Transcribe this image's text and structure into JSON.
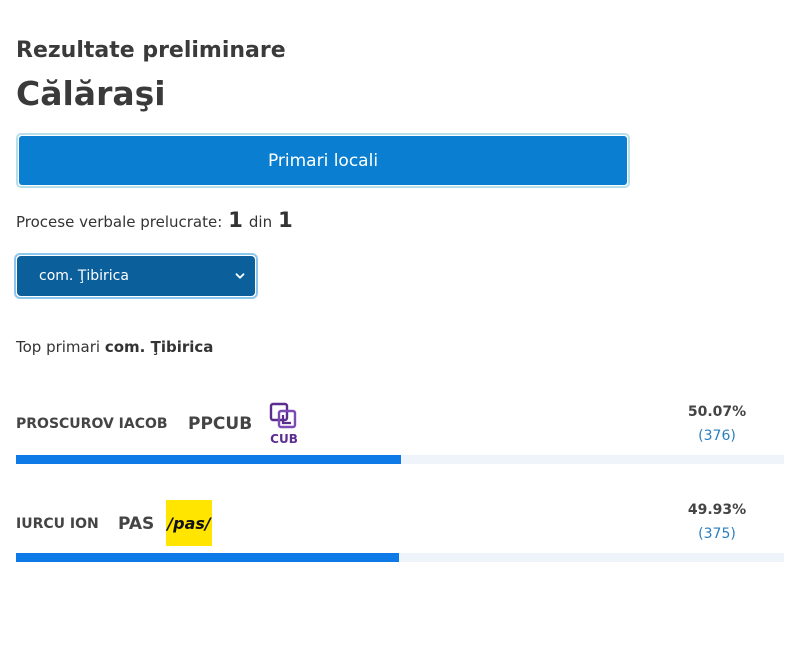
{
  "header": {
    "subtitle": "Rezultate preliminare",
    "title": "Călăraşi"
  },
  "tab": {
    "label": "Primari locali"
  },
  "progress": {
    "label": "Procese verbale prelucrate:",
    "done": "1",
    "sep": "din",
    "total": "1"
  },
  "locality_select": {
    "selected": "com. Ţibirica"
  },
  "top": {
    "prefix": "Top primari",
    "locality": "com. Ţibirica"
  },
  "candidates": [
    {
      "name": "PROSCUROV IACOB",
      "party": "PPCUB",
      "logo": "cub-logo",
      "logo_text": "CUB",
      "percent": "50.07%",
      "votes": "(376)",
      "share": 50.07,
      "logo_color": "#5b2d8e"
    },
    {
      "name": "IURCU ION",
      "party": "PAS",
      "logo": "pas-logo",
      "logo_text": "/pas/",
      "percent": "49.93%",
      "votes": "(375)",
      "share": 49.93,
      "logo_color": "#ffe500"
    }
  ],
  "colors": {
    "accent": "#0a7fd1",
    "select": "#0b5f9a",
    "bar": "#0d7ae8",
    "bar_bg": "#eef4f9"
  }
}
